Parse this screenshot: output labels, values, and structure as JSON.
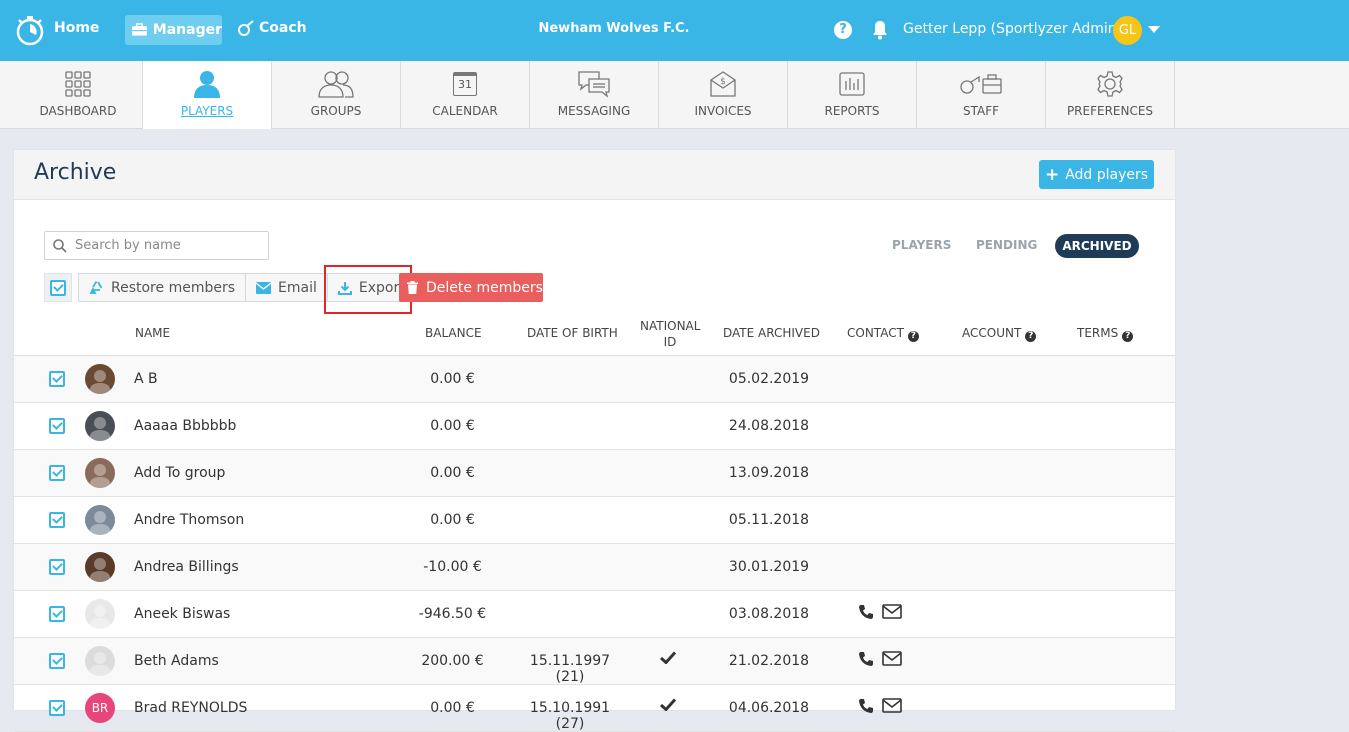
{
  "topbar": {
    "home": "Home",
    "manager": "Manager",
    "coach": "Coach",
    "team_name": "Newham Wolves F.C.",
    "help": "?",
    "user_name": "Getter Lepp (Sportlyzer Admin)",
    "user_initials": "GL"
  },
  "modules": [
    {
      "label": "DASHBOARD"
    },
    {
      "label": "PLAYERS"
    },
    {
      "label": "GROUPS"
    },
    {
      "label": "CALENDAR",
      "day": "31"
    },
    {
      "label": "MESSAGING"
    },
    {
      "label": "INVOICES"
    },
    {
      "label": "REPORTS"
    },
    {
      "label": "STAFF"
    },
    {
      "label": "PREFERENCES"
    }
  ],
  "page": {
    "title": "Archive",
    "add_button": "Add players",
    "search_placeholder": "Search by name",
    "filters": {
      "players": "PLAYERS",
      "pending": "PENDING",
      "archived": "ARCHIVED"
    },
    "actions": {
      "restore": "Restore members",
      "email": "Email",
      "export": "Export",
      "delete": "Delete members"
    }
  },
  "table": {
    "columns": {
      "name": "NAME",
      "balance": "BALANCE",
      "dob": "DATE OF BIRTH",
      "national_id_1": "NATIONAL",
      "national_id_2": "ID",
      "archived": "DATE ARCHIVED",
      "contact": "CONTACT",
      "account": "ACCOUNT",
      "terms": "TERMS"
    },
    "rows": [
      {
        "name": "A B",
        "balance": "0.00 €",
        "dob": "",
        "national_id": false,
        "archived": "05.02.2019",
        "contact": false,
        "avatar_color": "#6b4a35"
      },
      {
        "name": "Aaaaa Bbbbbb",
        "balance": "0.00 €",
        "dob": "",
        "national_id": false,
        "archived": "24.08.2018",
        "contact": false,
        "avatar_color": "#4a4e57"
      },
      {
        "name": "Add To group",
        "balance": "0.00 €",
        "dob": "",
        "national_id": false,
        "archived": "13.09.2018",
        "contact": false,
        "avatar_color": "#8a6a5a"
      },
      {
        "name": "Andre Thomson",
        "balance": "0.00 €",
        "dob": "",
        "national_id": false,
        "archived": "05.11.2018",
        "contact": false,
        "avatar_color": "#7d8a99"
      },
      {
        "name": "Andrea Billings",
        "balance": "-10.00 €",
        "dob": "",
        "national_id": false,
        "archived": "30.01.2019",
        "contact": false,
        "avatar_color": "#5a3a28"
      },
      {
        "name": "Aneek Biswas",
        "balance": "-946.50 €",
        "dob": "",
        "national_id": false,
        "archived": "03.08.2018",
        "contact": true,
        "avatar_color": "#e8e8e8"
      },
      {
        "name": "Beth Adams",
        "balance": "200.00 €",
        "dob": "15.11.1997 (21)",
        "national_id": true,
        "archived": "21.02.2018",
        "contact": true,
        "avatar_color": "#dcdcdc"
      },
      {
        "name": "Brad REYNOLDS",
        "balance": "0.00 €",
        "dob": "15.10.1991 (27)",
        "national_id": true,
        "archived": "04.06.2018",
        "contact": true,
        "avatar_color": "#e8457a",
        "initials": "BR"
      }
    ]
  },
  "colors": {
    "brand": "#3ab6e6",
    "dark": "#1f3b57",
    "danger": "#eb5e5e",
    "highlight": "#e0262b"
  }
}
